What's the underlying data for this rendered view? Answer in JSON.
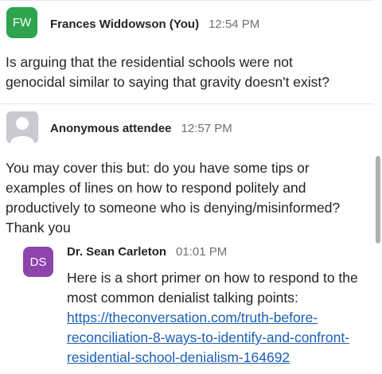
{
  "messages": [
    {
      "initials": "FW",
      "avatar_color": "#2ea44f",
      "name": "Frances Widdowson (You)",
      "time": "12:54 PM",
      "lines": [
        "Is arguing that the residential schools were not",
        "genocidal similar to saying that gravity doesn't exist?"
      ]
    },
    {
      "avatar_icon": "person-icon",
      "name": "Anonymous attendee",
      "time": "12:57 PM",
      "lines": [
        "You may cover this but: do you have some tips or",
        "examples of lines on how to respond politely and",
        "productively to someone who is denying/misinformed?",
        "Thank you"
      ]
    },
    {
      "initials": "DS",
      "avatar_color": "#8e44ad",
      "name": "Dr. Sean Carleton",
      "time": "01:01 PM",
      "lines": [
        "Here is a short primer on how to respond to the",
        "most common denialist talking points:"
      ],
      "link_lines": [
        "https://theconversation.com/truth-before-",
        "reconciliation-8-ways-to-identify-and-confront-",
        "residential-school-denialism-164692"
      ]
    }
  ]
}
